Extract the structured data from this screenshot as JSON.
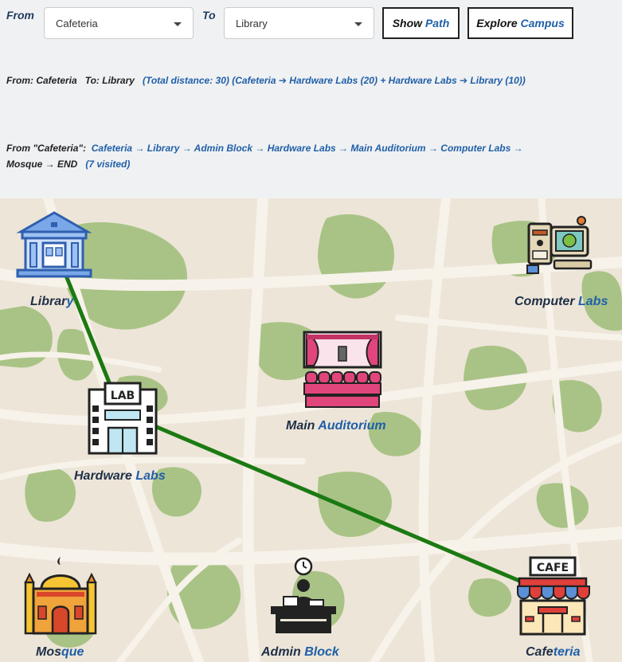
{
  "controls": {
    "from_label": "From",
    "to_label": "To",
    "from_value": "Cafeteria",
    "to_value": "Library",
    "show_path": {
      "a": "Show ",
      "b": "Path"
    },
    "explore": {
      "a": "Explore ",
      "b": "Campus"
    }
  },
  "path_info": {
    "from_prefix": "From: Cafeteria",
    "to_prefix": "To: Library",
    "detail": "(Total distance: 30) (Cafeteria ➔ Hardware Labs (20) + Hardware Labs ➔ Library (10))"
  },
  "explore_info": {
    "prefix": "From \"Cafeteria\":",
    "line1": "Cafeteria → Library → Admin Block → Hardware Labs → Main Auditorium → Computer Labs →",
    "line2": "Mosque → END",
    "visited": "(7 visited)"
  },
  "places": {
    "library": {
      "a": "Librar",
      "b": "y"
    },
    "computer_labs": {
      "a": "Computer ",
      "b": "Labs"
    },
    "main_auditorium": {
      "a": "Main ",
      "b": "Auditorium"
    },
    "hardware_labs": {
      "a": "Hardware ",
      "b": "Labs"
    },
    "mosque": {
      "a": "Mos",
      "b": "que"
    },
    "admin_block": {
      "a": "Admin ",
      "b": "Block"
    },
    "cafeteria": {
      "a": "Cafe",
      "b": "teria"
    }
  },
  "icon_text": {
    "cafe_sign": "CAFE",
    "lab_sign": "LAB"
  },
  "colors": {
    "path": "#1b7a12",
    "park": "#a9c386",
    "road": "#f7f2ea",
    "ground": "#ede5d8",
    "accent": "#1f5fa8"
  }
}
